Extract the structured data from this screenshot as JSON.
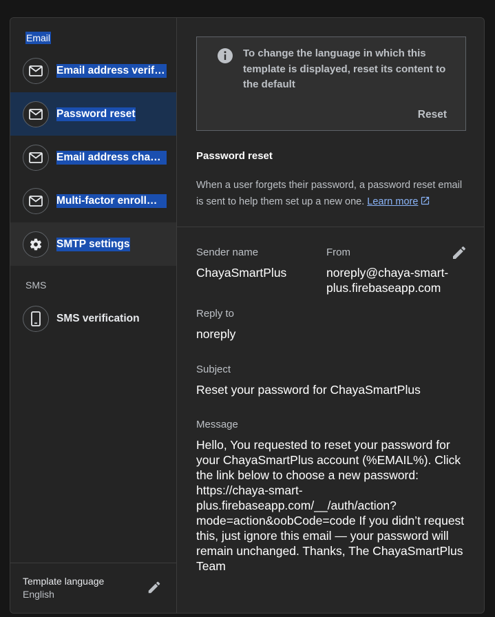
{
  "sidebar": {
    "email_section": "Email",
    "email_items": [
      {
        "label": "Email address verification",
        "icon": "mail-icon"
      },
      {
        "label": "Password reset",
        "icon": "mail-icon"
      },
      {
        "label": "Email address change",
        "icon": "mail-icon"
      },
      {
        "label": "Multi-factor enrollment",
        "icon": "mail-icon"
      },
      {
        "label": "SMTP settings",
        "icon": "gear-icon"
      }
    ],
    "sms_section": "SMS",
    "sms_items": [
      {
        "label": "SMS verification",
        "icon": "phone-icon"
      }
    ],
    "footer": {
      "title": "Template language",
      "value": "English"
    }
  },
  "main": {
    "info_banner": {
      "message": "To change the language in which this template is displayed, reset its content to the default",
      "reset_label": "Reset"
    },
    "title": "Password reset",
    "description": "When a user forgets their password, a password reset email is sent to help them set up a new one.",
    "learn_more": "Learn more",
    "sender_name_label": "Sender name",
    "sender_name": "ChayaSmartPlus",
    "from_label": "From",
    "from_value": "noreply@chaya-smart-plus.firebaseapp.com",
    "reply_to_label": "Reply to",
    "reply_to": "noreply",
    "subject_label": "Subject",
    "subject": "Reset your password for ChayaSmartPlus",
    "message_label": "Message",
    "message": "Hello, You requested to reset your password for your ChayaSmartPlus account (%EMAIL%). Click the link below to choose a new password: https://chaya-smart-plus.firebaseapp.com/__/auth/action?mode=action&oobCode=code If you didn’t request this, just ignore this email — your password will remain unchanged. Thanks, The ChayaSmartPlus Team"
  },
  "colors": {
    "background": "#262626",
    "active_item": "#1a3150",
    "selection": "#1a4fb0",
    "link": "#8ab4f8"
  }
}
